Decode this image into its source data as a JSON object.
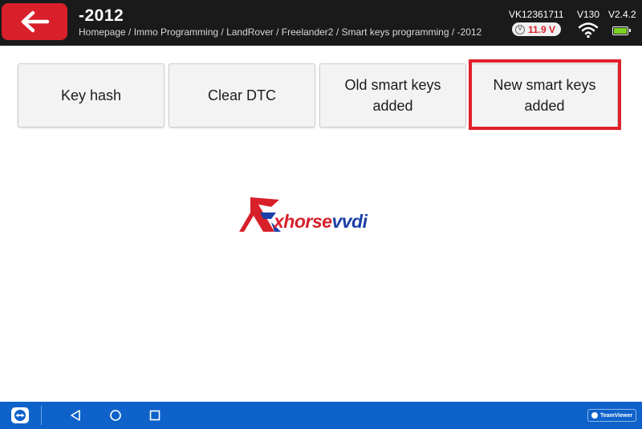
{
  "header": {
    "title": "-2012",
    "breadcrumb": "Homepage / Immo Programming / LandRover / Freelander2 / Smart keys programming / -2012",
    "serial": "VK12361711",
    "version": "V130",
    "app_version": "V2.4.2",
    "voltage": "11.9 V",
    "voltage_icon_glyph": "V",
    "icons": [
      "back-arrow-icon",
      "voltmeter-icon",
      "wifi-icon",
      "battery-icon"
    ],
    "accent_color": "#d8202b"
  },
  "options": [
    {
      "label": "Key hash"
    },
    {
      "label": "Clear DTC"
    },
    {
      "label": "Old smart keys\nadded"
    },
    {
      "label": "New smart keys\nadded",
      "highlighted": true
    }
  ],
  "logo": {
    "part1": "xhorse",
    "part2": "vvdi"
  },
  "navbar": {
    "teamviewer_label": "TeamViewer",
    "icons": [
      "teamviewer-app-icon",
      "nav-back-icon",
      "nav-home-icon",
      "nav-recent-icon"
    ],
    "bar_color": "#0e62c9"
  }
}
